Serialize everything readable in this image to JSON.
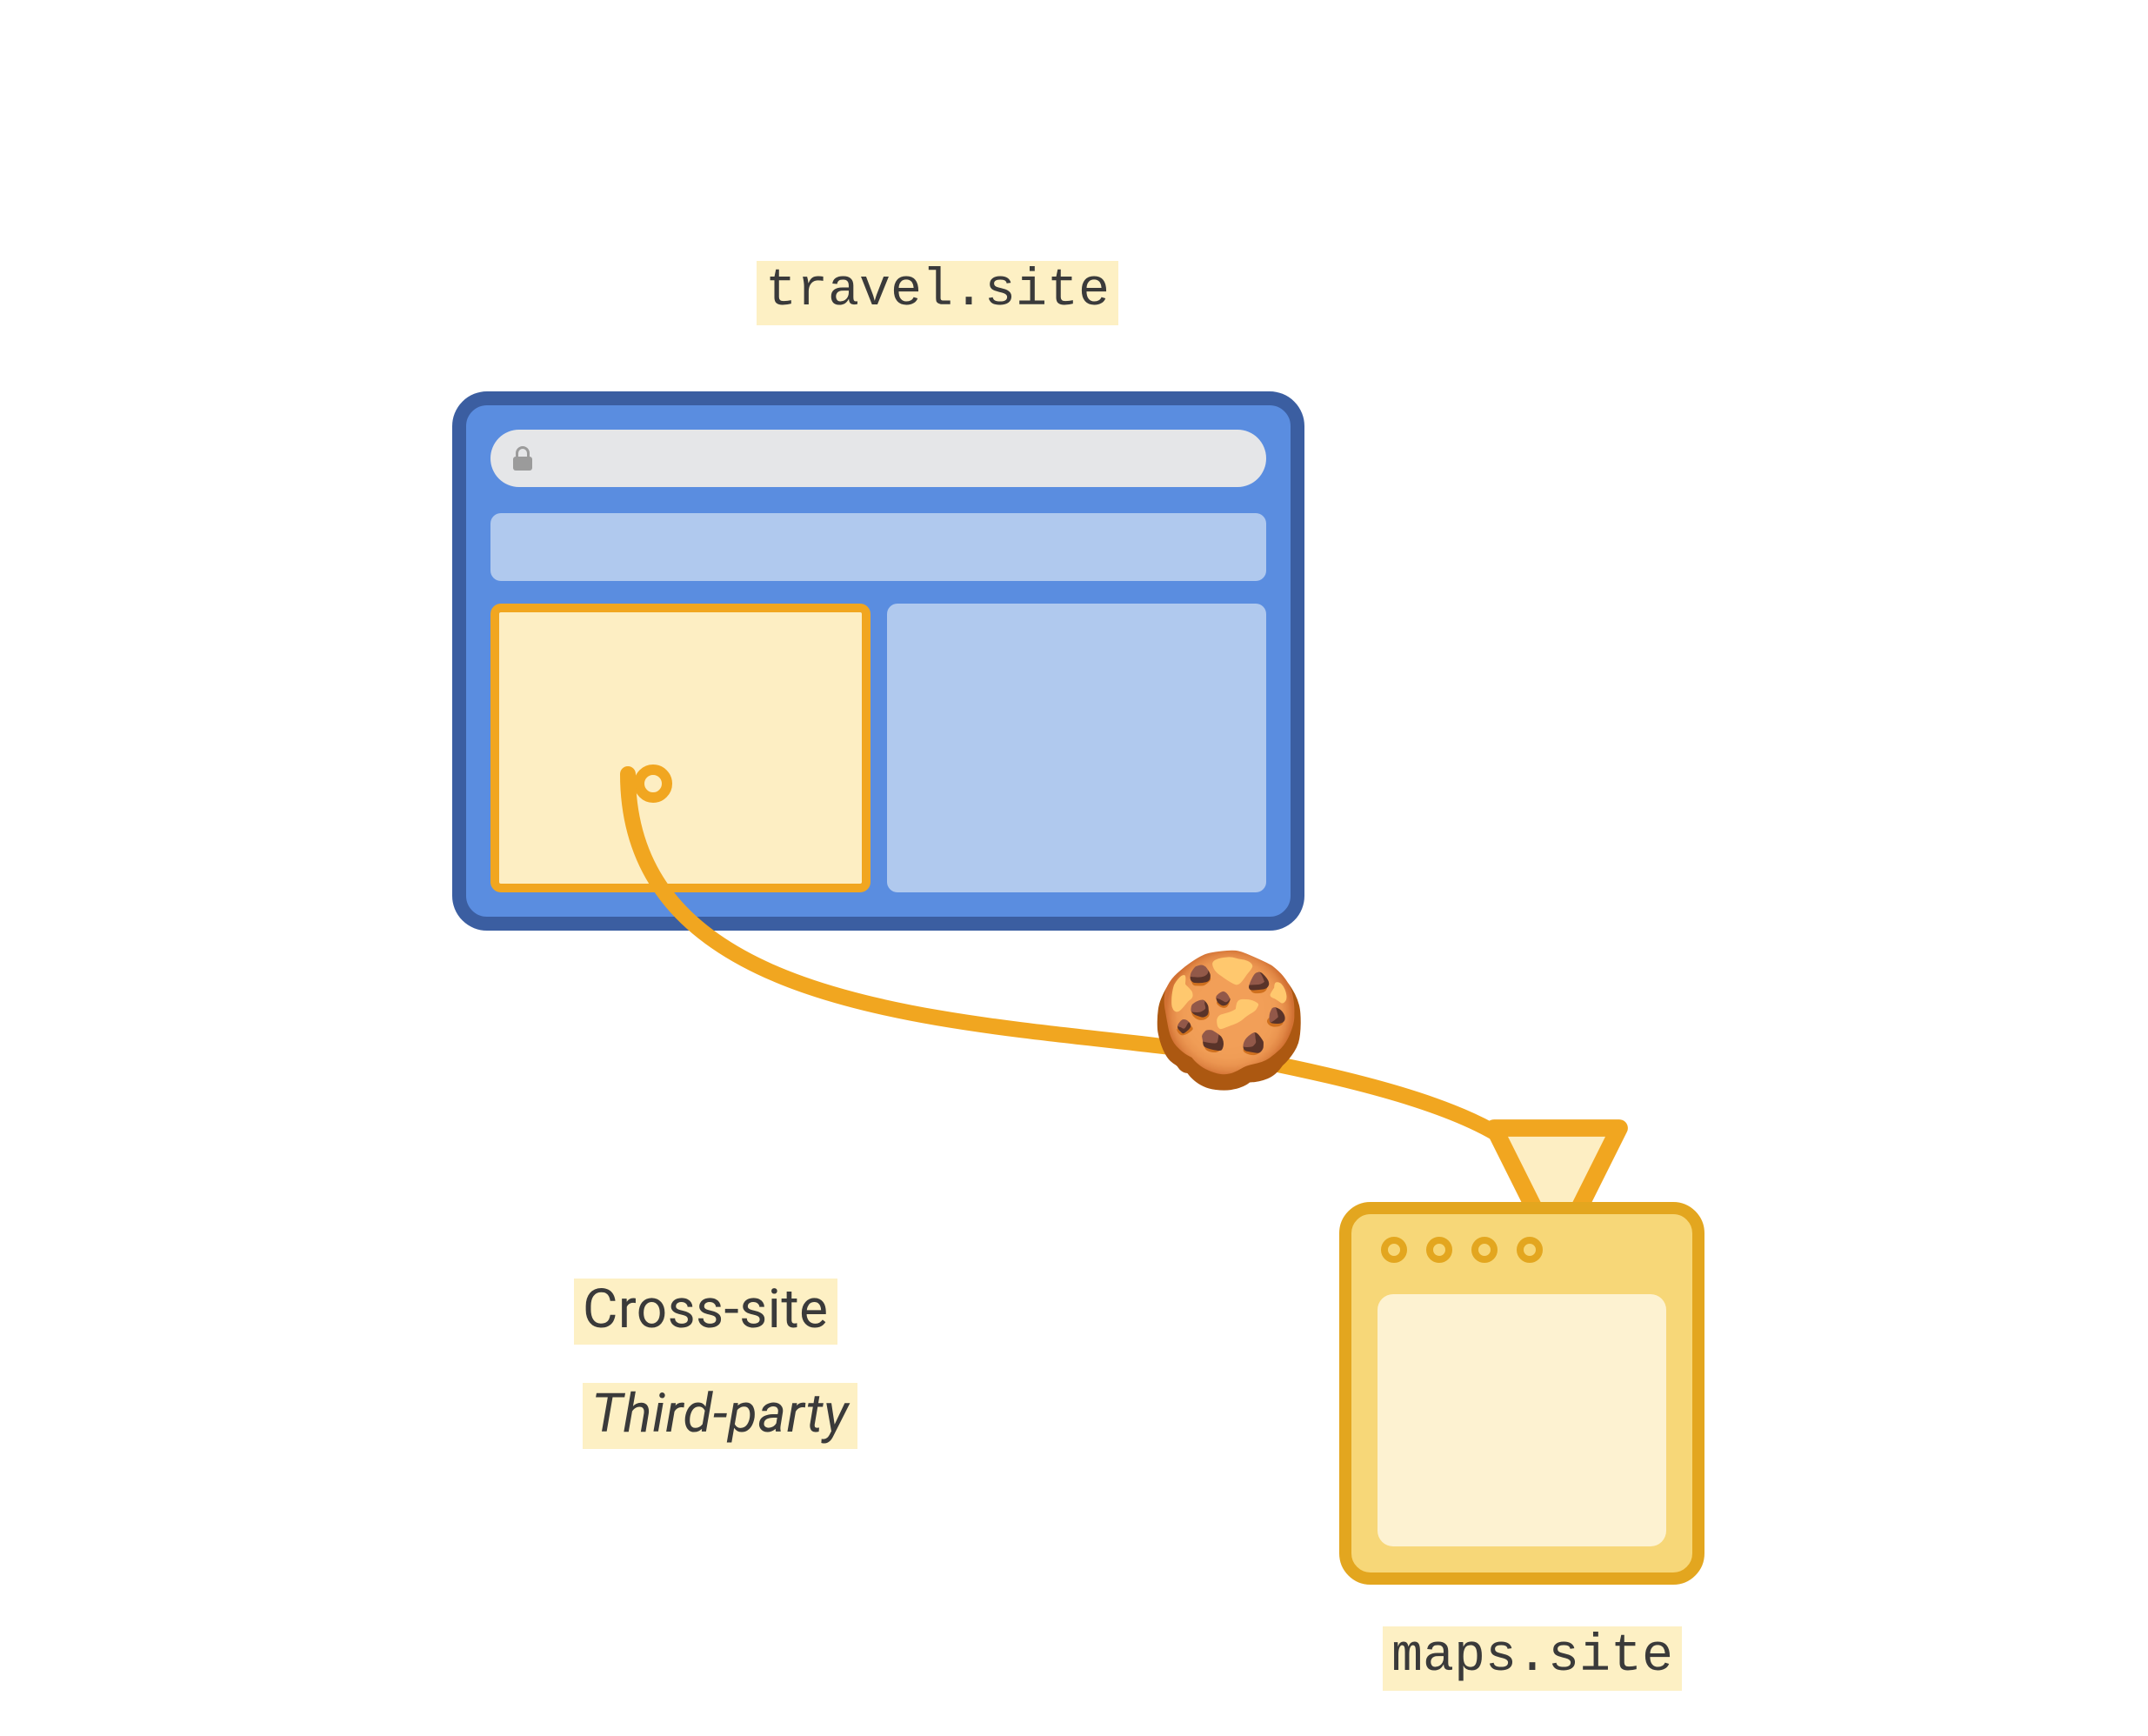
{
  "labels": {
    "top_site": "travel.site",
    "bottom_site": "maps.site",
    "cross_site": "Cross-site",
    "third_party": "Third-party"
  },
  "icons": {
    "cookie": "🍪",
    "lock": "lock"
  },
  "colors": {
    "highlight_bg": "#fdf0c4",
    "browser_border": "#3b5ea1",
    "browser_fill": "#5a8de0",
    "panel_blue": "#b0c9ee",
    "accent_orange": "#f1a620",
    "accent_fill": "#fdeec3",
    "server_border": "#e3a61f",
    "server_fill": "#f7d778"
  }
}
